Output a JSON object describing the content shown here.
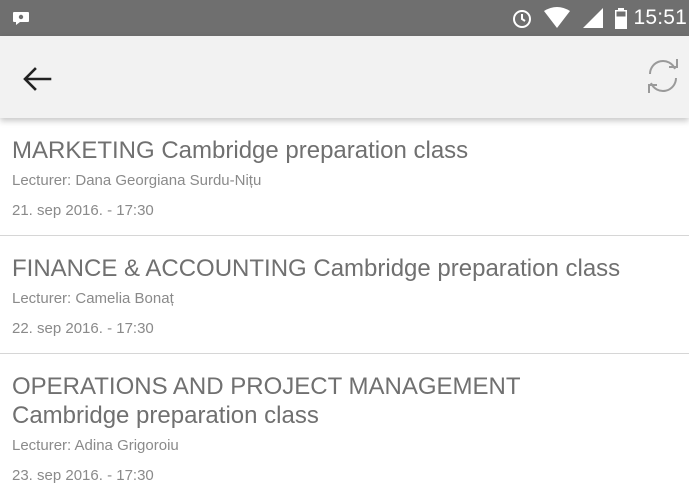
{
  "status_bar": {
    "time": "15:51",
    "icons": [
      "notification-icon",
      "alarm-icon",
      "wifi-icon",
      "signal-icon",
      "battery-icon"
    ],
    "background_color": "#6f6f6f"
  },
  "toolbar": {
    "back_icon": "arrow-back-icon",
    "refresh_icon": "refresh-icon",
    "background_color": "#f2f2f2"
  },
  "events": [
    {
      "title": "MARKETING Cambridge preparation class",
      "lecturer": "Lecturer: Dana Georgiana Surdu-Nițu",
      "datetime": "21. sep 2016. - 17:30"
    },
    {
      "title": "FINANCE & ACCOUNTING Cambridge preparation class",
      "lecturer": "Lecturer: Camelia Bonaț",
      "datetime": "22. sep 2016. - 17:30"
    },
    {
      "title": "OPERATIONS AND PROJECT MANAGEMENT Cambridge preparation class",
      "lecturer": "Lecturer: Adina Grigoroiu",
      "datetime": "23. sep 2016. - 17:30"
    }
  ]
}
